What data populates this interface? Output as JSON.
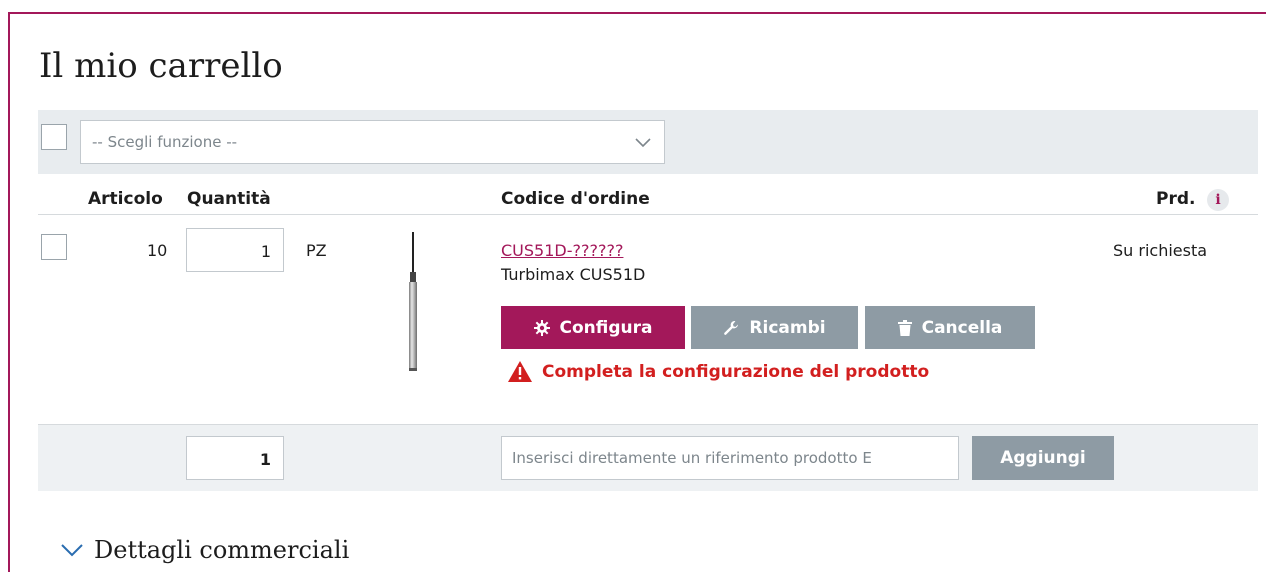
{
  "page": {
    "title": "Il mio carrello"
  },
  "toolbar": {
    "function_select": "-- Scegli funzione --",
    "icons": {
      "select_chevron": "chevron-down-icon"
    }
  },
  "table": {
    "headers": {
      "articolo": "Articolo",
      "quantita": "Quantità",
      "codice": "Codice d'ordine",
      "prd": "Prd.",
      "info": "i"
    },
    "items": [
      {
        "article": "10",
        "quantity": "1",
        "unit": "PZ",
        "order_code": "CUS51D-??????",
        "product_name": "Turbimax CUS51D",
        "availability": "Su richiesta",
        "buttons": {
          "configure": "Configura",
          "spare_parts": "Ricambi",
          "delete": "Cancella"
        },
        "warning": "Completa la configurazione del prodotto"
      }
    ]
  },
  "add_row": {
    "quantity": "1",
    "reference_placeholder": "Inserisci direttamente un riferimento prodotto E",
    "add_button": "Aggiungi"
  },
  "details": {
    "label": "Dettagli commerciali"
  },
  "colors": {
    "accent": "#a3185a",
    "secondary_button": "#8e9ba4",
    "warning": "#d21f1f",
    "band": "#e8ecef"
  }
}
